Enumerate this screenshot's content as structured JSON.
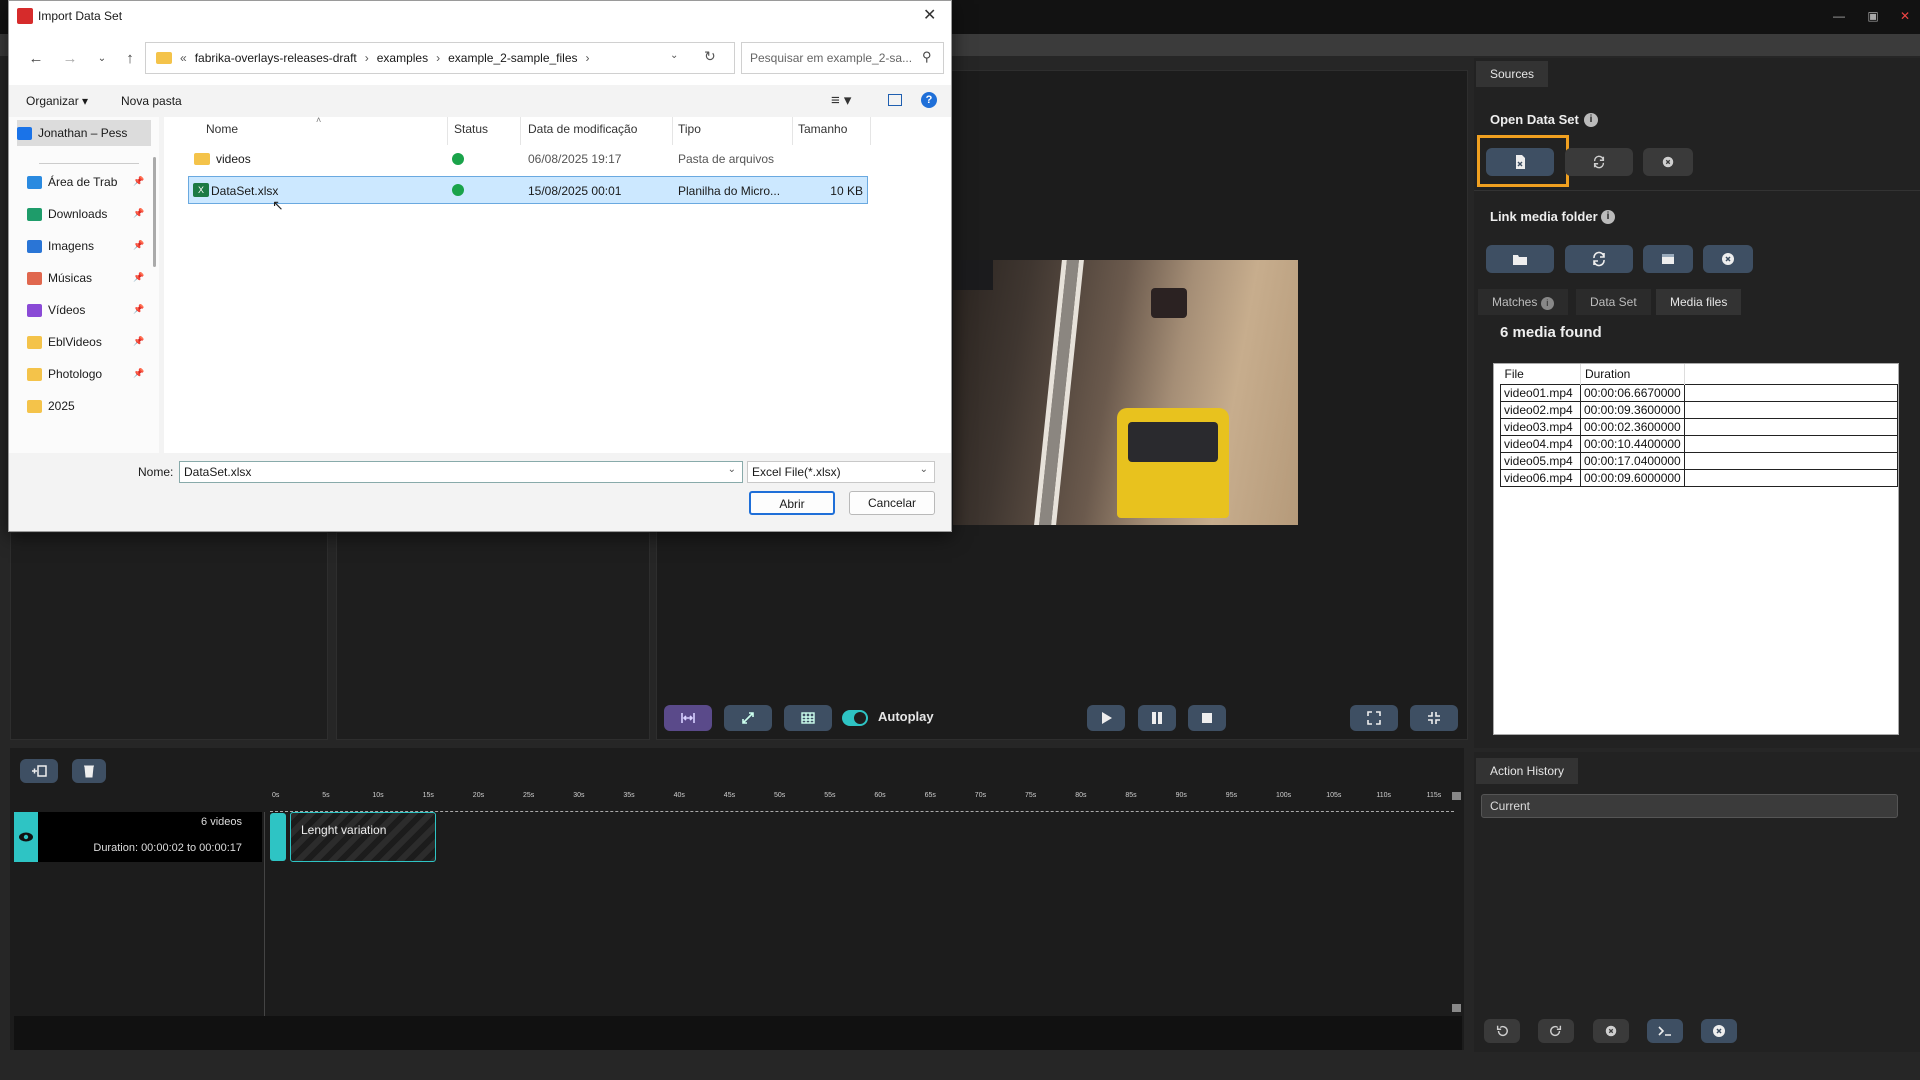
{
  "dialog": {
    "title": "Import Data Set",
    "breadcrumb": [
      "fabrika-overlays-releases-draft",
      "examples",
      "example_2-sample_files"
    ],
    "breadcrumb_prefix": "«",
    "search_placeholder": "Pesquisar em example_2-sa...",
    "organize_label": "Organizar",
    "new_folder_label": "Nova pasta",
    "nav_items": [
      {
        "label": "Jonathan – Pess",
        "icon": "onedrive-icon",
        "color": "#1a73e8",
        "pinned": false
      },
      {
        "label": "Área de Trab",
        "icon": "desktop-icon",
        "color": "#2a8ae0",
        "pinned": true
      },
      {
        "label": "Downloads",
        "icon": "download-icon",
        "color": "#1e9c6a",
        "pinned": true
      },
      {
        "label": "Imagens",
        "icon": "pictures-icon",
        "color": "#2a75d6",
        "pinned": true
      },
      {
        "label": "Músicas",
        "icon": "music-icon",
        "color": "#e0674e",
        "pinned": true
      },
      {
        "label": "Vídeos",
        "icon": "videos-icon",
        "color": "#8a4ad6",
        "pinned": true
      },
      {
        "label": "EblVideos",
        "icon": "folder-icon",
        "color": "#f4c34a",
        "pinned": true
      },
      {
        "label": "Photologo",
        "icon": "folder-icon",
        "color": "#f4c34a",
        "pinned": true
      },
      {
        "label": "2025",
        "icon": "folder-icon",
        "color": "#f4c34a",
        "pinned": false
      }
    ],
    "columns": [
      "Nome",
      "Status",
      "Data de modificação",
      "Tipo",
      "Tamanho"
    ],
    "files": [
      {
        "name": "videos",
        "date": "06/08/2025 19:17",
        "type": "Pasta de arquivos",
        "size": "",
        "selected": false,
        "icon": "folder-icon"
      },
      {
        "name": "DataSet.xlsx",
        "date": "15/08/2025 00:01",
        "type": "Planilha do Micro...",
        "size": "10 KB",
        "selected": true,
        "icon": "excel-file-icon"
      }
    ],
    "filename_label": "Nome:",
    "filename_value": "DataSet.xlsx",
    "filetype_value": "Excel File(*.xlsx)",
    "open_label": "Abrir",
    "cancel_label": "Cancelar"
  },
  "sources": {
    "tab_label": "Sources",
    "open_dataset_label": "Open Data Set",
    "link_media_label": "Link media folder",
    "tabs": [
      "Matches",
      "Data Set",
      "Media files"
    ],
    "active_tab": "Media files",
    "media_found": "6 media found",
    "media_columns": [
      "File",
      "Duration"
    ],
    "media_rows": [
      [
        "video01.mp4",
        "00:00:06.6670000"
      ],
      [
        "video02.mp4",
        "00:00:09.3600000"
      ],
      [
        "video03.mp4",
        "00:00:02.3600000"
      ],
      [
        "video04.mp4",
        "00:00:10.4400000"
      ],
      [
        "video05.mp4",
        "00:00:17.0400000"
      ],
      [
        "video06.mp4",
        "00:00:09.6000000"
      ]
    ]
  },
  "player": {
    "autoplay_label": "Autoplay"
  },
  "history": {
    "tab_label": "Action History",
    "current_label": "Current"
  },
  "timeline": {
    "track_count": "6 videos",
    "track_duration": "Duration: 00:00:02 to 00:00:17",
    "clip_label": "Lenght variation",
    "ticks": [
      "0s",
      "5s",
      "10s",
      "15s",
      "20s",
      "25s",
      "30s",
      "35s",
      "40s",
      "45s",
      "50s",
      "55s",
      "60s",
      "65s",
      "70s",
      "75s",
      "80s",
      "85s",
      "90s",
      "95s",
      "100s",
      "105s",
      "110s",
      "115s"
    ]
  },
  "colors": {
    "accent_orange": "#f0a020",
    "teal": "#2ec4c4",
    "button_blue": "#3e4f63",
    "button_purple": "#5a4a8a"
  }
}
